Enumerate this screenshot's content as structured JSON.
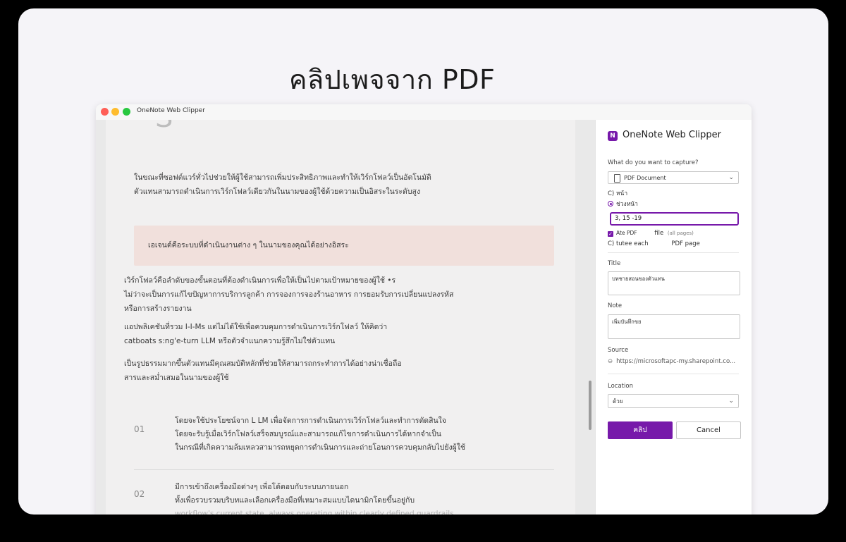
{
  "headline": "คลิปเพจจาก PDF",
  "window": {
    "title": "OneNote Web Clipper"
  },
  "document": {
    "big_char": "S",
    "para1": [
      "ในขณะที่ซอฟต์แวร์ทั่วไปช่วยให้ผู้ใช้สามารถเพิ่มประสิทธิภาพและทำให้เวิร์กโฟลว์เป็นอัตโนมัติ",
      "ตัวแทนสามารถดำเนินการเวิร์กโฟลว์เดียวกันในนามของผู้ใช้ด้วยความเป็นอิสระในระดับสูง"
    ],
    "callout": "เอเจนต์คือระบบที่ดำเนินงานต่าง ๆ ในนามของคุณได้อย่างอิสระ",
    "para2": [
      "เวิร์กโฟลว์คือลำดับของขั้นตอนที่ต้องดำเนินการเพื่อให้เป็นไปตามเป้าหมายของผู้ใช้ •ร",
      "ไม่ว่าจะเป็นการแก้ไขปัญหาการบริการลูกค้า การจองการจองร้านอาหาร การยอมรับการเปลี่ยนแปลงรหัส",
      "หรือการสร้างรายงาน"
    ],
    "para3": [
      "แอปพลิเคชันที่รวม I-I-Ms แต่ไม่ได้ใช้เพื่อควบคุมการดำเนินการเวิร์กโฟลว์ ให้คิดว่า",
      "catboats s:ng'e-turn LLM หรือตัวจำแนกความรู้สึกไม่ใช่ตัวแทน"
    ],
    "para4": [
      "เป็นรูปธรรมมากขึ้นตัวแทนมีคุณสมบัติหลักที่ช่วยให้สามารถกระทำการได้อย่างน่าเชื่อถือ",
      "สารและสม่ำเสมอในนามของผู้ใช้"
    ],
    "steps": [
      {
        "num": "01",
        "lines": [
          "โดยจะใช้ประโยชน์จาก L LM เพื่อจัดการการดำเนินการเวิร์กโฟลว์และทำการตัดสินใจ",
          "โดยจะรับรู้เมื่อเวิร์กโฟลว์เสร็จสมบูรณ์และสามารถแก้ไขการดำเนินการได้หากจำเป็น",
          "ในกรณีที่เกิดความล้มเหลวสามารถหยุดการดำเนินการและถ่ายโอนการควบคุมกลับไปยังผู้ใช้"
        ]
      },
      {
        "num": "02",
        "lines": [
          "มีการเข้าถึงเครื่องมือต่างๆ เพื่อโต้ตอบกับระบบภายนอก",
          "ทั้งเพื่อรวบรวมบริบทและเลือกเครื่องมือที่เหมาะสมแบบไดนามิกโดยขึ้นอยู่กับ"
        ],
        "faded": "workflow's current state, always operating within clearly defined guardrails."
      }
    ]
  },
  "clipper": {
    "brand": "OneNote Web Clipper",
    "capture_label": "What do you want to capture?",
    "capture_value": "PDF Document",
    "option_pages": "C) หน้า",
    "option_range": "ช่วงหน้า",
    "pages_value": "3, 15 -19",
    "attach_pdf_label": "Ate PDF",
    "attach_pdf_file": "file",
    "attach_pdf_note": "(all pages)",
    "option_each": "C) tutee each",
    "option_each_tail": "PDF page",
    "title_label": "Title",
    "title_value": "บทชายสอนของตัวแทน",
    "note_label": "Note",
    "note_value": "เพิ่มบันทึกขย",
    "source_label": "Source",
    "source_value": "https://microsoftapc-my.sharepoint.co...",
    "location_label": "Location",
    "location_value": "ด้วย",
    "clip_button": "คลิป",
    "cancel_button": "Cancel"
  },
  "colors": {
    "accent": "#7719aa",
    "callout_bg": "#f1e0dc"
  }
}
